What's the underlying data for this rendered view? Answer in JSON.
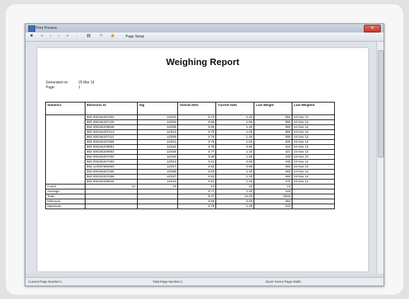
{
  "window": {
    "title": "Print Preview"
  },
  "toolbar": {
    "page_setup_label": "Page Setup"
  },
  "report": {
    "title": "Weighing Report",
    "generated_label": "Generated on:",
    "generated_value": "25 Mar 16",
    "page_label": "Page:",
    "page_value": "1"
  },
  "table": {
    "headers": [
      "Statistics",
      "Electronic Id",
      "Tag",
      "Overall ADG",
      "Current ADG",
      "Last Weight",
      "Last Weighed"
    ],
    "rows": [
      [
        "",
        "982 000184207494",
        "11/023",
        "0.72",
        "1.20",
        "350",
        "24 Nov 12"
      ],
      [
        "",
        "982 000184207130",
        "11/002",
        "0.65",
        "1.55",
        "380",
        "24 Nov 12"
      ],
      [
        "",
        "982 000184209948",
        "11/006",
        "0.65",
        "1.40",
        "380",
        "24 Nov 12"
      ],
      [
        "",
        "982 000184207413",
        "11/014",
        "0.75",
        "1.05",
        "380",
        "24 Nov 12"
      ],
      [
        "",
        "982 000184207112",
        "11/009",
        "0.75",
        "1.40",
        "390",
        "24 Nov 12"
      ],
      [
        "",
        "982 000184207505",
        "11/021",
        "0.76",
        "1.02",
        "400",
        "24 Nov 12"
      ],
      [
        "",
        "982 000184209951",
        "11/022",
        "0.78",
        "0.90",
        "410",
        "24 Nov 12"
      ],
      [
        "",
        "982 000184209953",
        "11/026",
        "0.77",
        "1.10",
        "421",
        "24 Nov 12"
      ],
      [
        "",
        "982 000184207284",
        "11/030",
        "0.85",
        "1.50",
        "430",
        "24 Nov 12"
      ],
      [
        "",
        "982 000184207283",
        "11/012",
        "0.81",
        "0.60",
        "430",
        "24 Nov 12"
      ],
      [
        "",
        "982 123497660060",
        "11/017",
        "0.82",
        "0.90",
        "450",
        "24 Nov 14"
      ],
      [
        "",
        "982 000184207285",
        "11/005",
        "0.83",
        "1.40",
        "460",
        "24 Nov 12"
      ],
      [
        "",
        "982 000181207488",
        "11/027",
        "0.82",
        "1.10",
        "460",
        "24 Nov 12"
      ],
      [
        "",
        "982 000184209944",
        "11/031",
        "0.81",
        "1.40",
        "470",
        "24 Nov 12"
      ]
    ],
    "summary": [
      [
        "Count:",
        "14",
        "14",
        "14",
        "14",
        "14",
        ""
      ],
      [
        "Average:",
        "",
        "",
        "0.77",
        "1.20",
        "416",
        ""
      ],
      [
        "Total:",
        "",
        "",
        "8.37",
        "12.20",
        "5826",
        ""
      ],
      [
        "Minimum:",
        "",
        "",
        "0.58",
        "0.40",
        "350",
        ""
      ],
      [
        "Maximum:",
        "",
        "",
        "0.78",
        "1.20",
        "470",
        ""
      ]
    ]
  },
  "status": {
    "current_page": "Current Page Number:1",
    "total_page": "Total Page Number:1",
    "zoom": "Zoom Factor:Page Width"
  },
  "icons": {
    "app": "print-preview-icon",
    "toolbar": [
      "print-icon",
      "first-page-icon",
      "prev-page-icon",
      "next-page-icon",
      "last-page-icon",
      "zoom-icon",
      "page-layout-icon",
      "settings-icon",
      "page-setup-icon"
    ]
  },
  "colors": {
    "accent": "#3d6fb1",
    "close": "#c03a2a"
  }
}
